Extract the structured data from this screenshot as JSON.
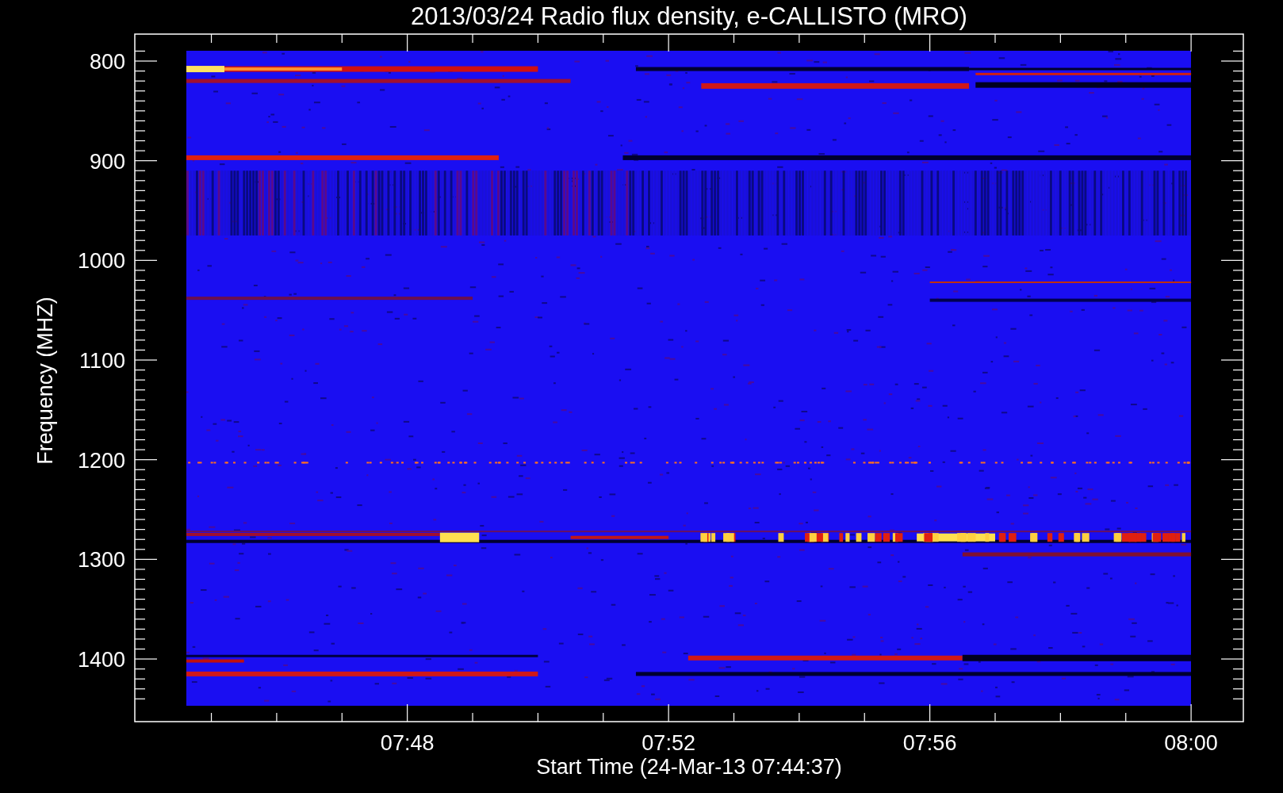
{
  "title": "2013/03/24  Radio flux density, e-CALLISTO (MRO)",
  "y_axis": {
    "label": "Frequency (MHZ)",
    "ticks": [
      "800",
      "900",
      "1000",
      "1100",
      "1200",
      "1300",
      "1400"
    ]
  },
  "x_axis": {
    "label": "Start Time (24-Mar-13 07:44:37)",
    "ticks": [
      "07:48",
      "07:52",
      "07:56",
      "08:00"
    ]
  }
}
